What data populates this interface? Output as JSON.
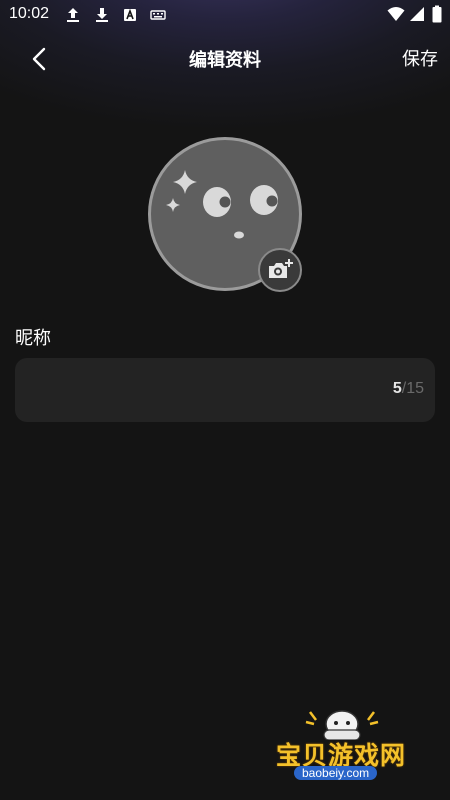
{
  "status_bar": {
    "time": "10:02",
    "left_icons": [
      "upload-icon",
      "download-icon",
      "a-box-icon",
      "keyboard-icon"
    ],
    "right_icons": [
      "wifi-icon",
      "signal-icon",
      "battery-icon"
    ]
  },
  "header": {
    "back_icon": "chevron-left-icon",
    "title": "编辑资料",
    "save_label": "保存"
  },
  "avatar": {
    "icon": "ghost-face-icon",
    "camera_icon": "camera-plus-icon"
  },
  "nickname": {
    "label": "昵称",
    "value": "",
    "count_current": "5",
    "count_separator": "/",
    "count_max": "15"
  },
  "watermark": {
    "text": "宝贝游戏网",
    "url": "baobeiy.com"
  },
  "colors": {
    "background": "#141414",
    "field_bg": "#232323",
    "accent_watermark": "#f4c12a"
  }
}
